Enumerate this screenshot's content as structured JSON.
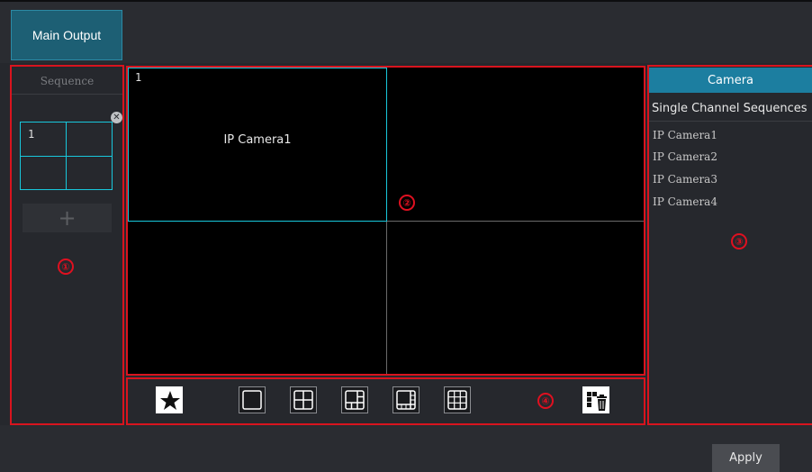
{
  "top": {
    "tab_label": "Main Output"
  },
  "sequence": {
    "title": "Sequence",
    "thumb_number": "1",
    "close_glyph": "✕",
    "add_glyph": "+"
  },
  "view": {
    "cell_number": "1",
    "cell_camera": "IP Camera1"
  },
  "camera_panel": {
    "header": "Camera",
    "subheader": "Single Channel Sequences",
    "items": [
      "IP Camera1",
      "IP Camera2",
      "IP Camera3",
      "IP Camera4"
    ]
  },
  "markers": [
    "①",
    "②",
    "③",
    "④"
  ],
  "toolbar_icons": [
    "star-icon",
    "layout-1-icon",
    "layout-4-icon",
    "layout-6-icon",
    "layout-8-icon",
    "layout-9-icon",
    "clear-all-icon"
  ],
  "footer": {
    "apply_label": "Apply"
  },
  "colors": {
    "accent": "#18c8dc",
    "annotation_red": "#d8141e",
    "header_blue": "#1c7ea0",
    "tab_blue": "#1d5f74"
  }
}
